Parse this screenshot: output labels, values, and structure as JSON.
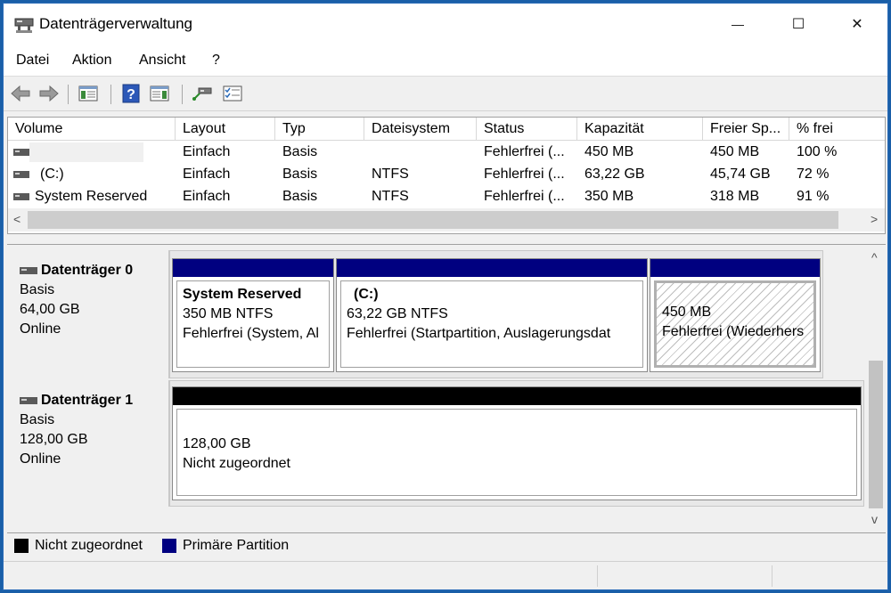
{
  "window": {
    "title": "Datenträgerverwaltung",
    "minimize_glyph": "—",
    "maximize_glyph": "☐",
    "close_glyph": "✕"
  },
  "menu": [
    "Datei",
    "Aktion",
    "Ansicht",
    "?"
  ],
  "toolbar": {
    "icons": [
      "back-icon",
      "forward-icon",
      "console-tree-icon",
      "help-icon",
      "properties-panel-icon",
      "connect-icon",
      "checklist-icon"
    ]
  },
  "volume_list": {
    "columns": [
      "Volume",
      "Layout",
      "Typ",
      "Dateisystem",
      "Status",
      "Kapazität",
      "Freier Sp...",
      "% frei"
    ],
    "rows": [
      {
        "volume": "",
        "layout": "Einfach",
        "typ": "Basis",
        "dateisystem": "",
        "status": "Fehlerfrei (...",
        "kapazitaet": "450 MB",
        "frei": "450 MB",
        "prozent": "100 %"
      },
      {
        "volume": "(C:)",
        "layout": "Einfach",
        "typ": "Basis",
        "dateisystem": "NTFS",
        "status": "Fehlerfrei (...",
        "kapazitaet": "63,22 GB",
        "frei": "45,74 GB",
        "prozent": "72 %"
      },
      {
        "volume": "System Reserved",
        "layout": "Einfach",
        "typ": "Basis",
        "dateisystem": "NTFS",
        "status": "Fehlerfrei (...",
        "kapazitaet": "350 MB",
        "frei": "318 MB",
        "prozent": "91 %"
      }
    ],
    "scroll_left_glyph": "<",
    "scroll_right_glyph": ">"
  },
  "disks": [
    {
      "name": "Datenträger 0",
      "type": "Basis",
      "size": "64,00 GB",
      "state": "Online",
      "partitions": [
        {
          "title": "System Reserved",
          "line1": "350 MB NTFS",
          "line2": "Fehlerfrei (System, Al"
        },
        {
          "title": "(C:)",
          "line1": "63,22 GB NTFS",
          "line2": "Fehlerfrei (Startpartition, Auslagerungsdat"
        },
        {
          "title": "",
          "line1": "450 MB",
          "line2": "Fehlerfrei (Wiederhers"
        }
      ]
    },
    {
      "name": "Datenträger 1",
      "type": "Basis",
      "size": "128,00 GB",
      "state": "Online",
      "partitions": [
        {
          "title": "",
          "line1": "128,00 GB",
          "line2": "Nicht zugeordnet"
        }
      ]
    }
  ],
  "scroll_up_glyph": "^",
  "scroll_down_glyph": "v",
  "legend": [
    {
      "label": "Nicht zugeordnet",
      "color": "#000000"
    },
    {
      "label": "Primäre Partition",
      "color": "#000080"
    }
  ],
  "colors": {
    "primary_partition": "#000080",
    "unallocated": "#000000"
  }
}
